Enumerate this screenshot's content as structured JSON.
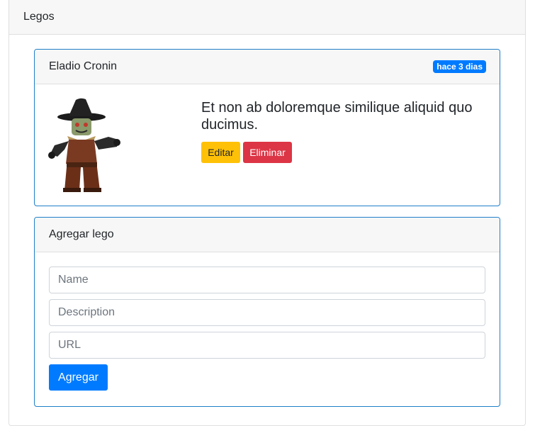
{
  "outer": {
    "title": "Legos"
  },
  "lego_item": {
    "name": "Eladio Cronin",
    "time_badge": "hace 3 dias",
    "description": "Et non ab doloremque similique aliquid quo ducimus.",
    "edit_label": "Editar",
    "delete_label": "Eliminar"
  },
  "add_form": {
    "title": "Agregar lego",
    "name_placeholder": "Name",
    "description_placeholder": "Description",
    "url_placeholder": "URL",
    "submit_label": "Agregar"
  },
  "colors": {
    "primary": "#007bff",
    "warning": "#ffc107",
    "danger": "#dc3545",
    "card_border": "#1e7fc8"
  },
  "icons": {
    "lego_image": "lego-scarecrow-figure"
  }
}
